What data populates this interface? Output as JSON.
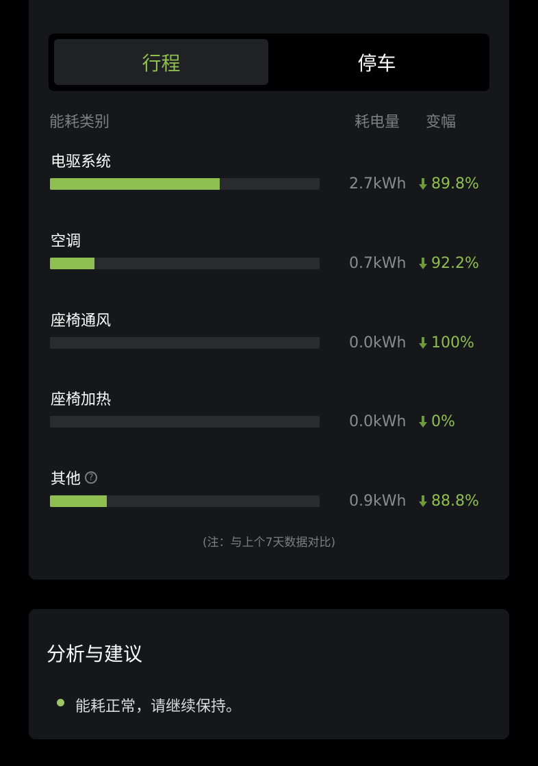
{
  "tabs": [
    {
      "label": "行程",
      "active": true
    },
    {
      "label": "停车",
      "active": false
    }
  ],
  "table_header": {
    "category": "能耗类别",
    "energy": "耗电量",
    "change": "变幅"
  },
  "rows": [
    {
      "label": "电驱系统",
      "value": "2.7kWh",
      "change": "89.8%",
      "fill": 0.63
    },
    {
      "label": "空调",
      "value": "0.7kWh",
      "change": "92.2%",
      "fill": 0.165
    },
    {
      "label": "座椅通风",
      "value": "0.0kWh",
      "change": "100%",
      "fill": 0
    },
    {
      "label": "座椅加热",
      "value": "0.0kWh",
      "change": "0%",
      "fill": 0
    },
    {
      "label": "其他",
      "value": "0.9kWh",
      "change": "88.8%",
      "fill": 0.21,
      "help": "?"
    }
  ],
  "note": "(注：与上个7天数据对比)",
  "advice": {
    "title": "分析与建议",
    "items": [
      "能耗正常，请继续保持。"
    ]
  },
  "colors": {
    "accent": "#8fbf4f",
    "card": "#16171b",
    "track": "#2a2b2e",
    "arrow": "#6f9a3c"
  }
}
